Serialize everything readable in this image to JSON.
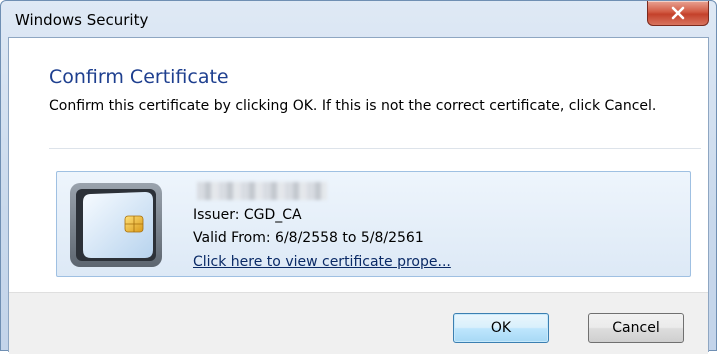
{
  "window": {
    "title": "Windows Security"
  },
  "dialog": {
    "heading": "Confirm Certificate",
    "message": "Confirm this certificate by clicking OK. If this is not the correct certificate, click Cancel."
  },
  "certificate": {
    "name": "",
    "issuer": "Issuer: CGD_CA",
    "valid": "Valid From: 6/8/2558 to 5/8/2561",
    "link": "Click here to view certificate prope..."
  },
  "buttons": {
    "ok": "OK",
    "cancel": "Cancel"
  },
  "icons": {
    "close": "close-icon",
    "card": "smart-card-icon"
  },
  "colors": {
    "heading": "#1e3f8f",
    "close_button": "#c4412b",
    "tile_border": "#9fc0e2"
  }
}
